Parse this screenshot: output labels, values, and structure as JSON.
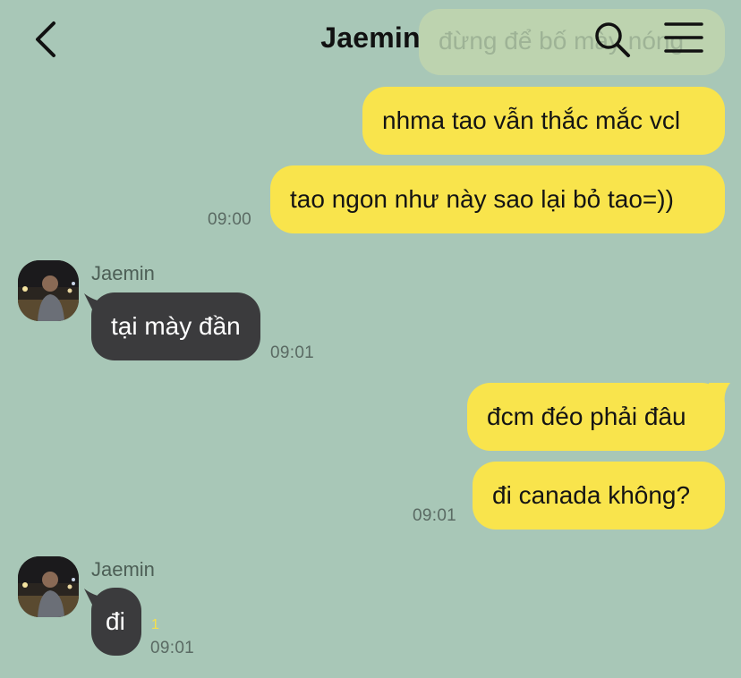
{
  "header": {
    "title": "Jaemin",
    "ghost_preview": "đừng để bố mày nóng"
  },
  "messages": {
    "m1": {
      "text": "nhma tao vẫn thắc mắc vcl"
    },
    "m2": {
      "text": "tao ngon như này sao lại bỏ tao=))",
      "time": "09:00"
    },
    "m3": {
      "sender": "Jaemin",
      "text": "tại mày đần",
      "time": "09:01"
    },
    "m4": {
      "text": "đcm đéo phải đâu"
    },
    "m5": {
      "text": "đi canada không?",
      "time": "09:01"
    },
    "m6": {
      "sender": "Jaemin",
      "text": "đi",
      "unread": "1",
      "time": "09:01"
    }
  },
  "colors": {
    "background": "#a8c7b7",
    "my_bubble": "#f9e44c",
    "their_bubble": "#3b3b3d",
    "unread": "#f6e04a"
  }
}
